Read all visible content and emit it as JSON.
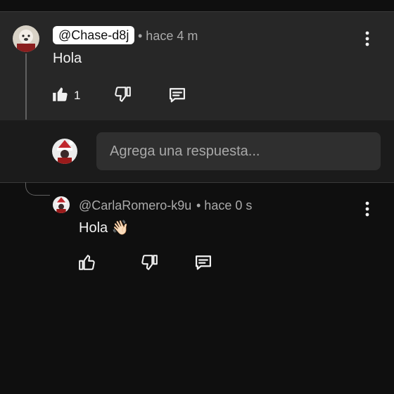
{
  "comment": {
    "username": "@Chase-d8j",
    "time": "• hace 4 m",
    "text": "Hola",
    "like_count": "1"
  },
  "reply_box": {
    "placeholder": "Agrega una respuesta..."
  },
  "reply": {
    "username": "@CarlaRomero-k9u",
    "time": "• hace 0 s",
    "text": "Hola",
    "emoji": "👋🏻"
  },
  "colors": {
    "background": "#0f0f0f",
    "highlighted_comment": "#272727",
    "text": "#f1f1f1",
    "muted": "#aaaaaa"
  }
}
